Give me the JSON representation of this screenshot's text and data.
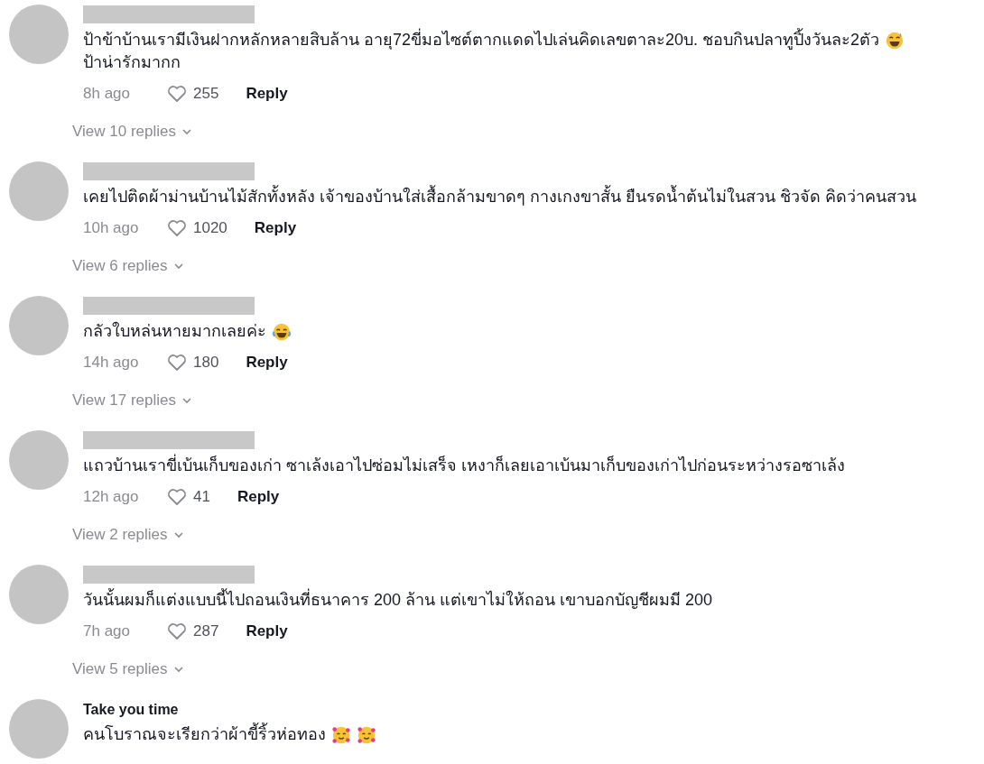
{
  "comments": [
    {
      "name_redacted": true,
      "lines": [
        [
          {
            "kind": "text",
            "text": "ป้าข้าบ้านเรามีเงินฝากหลักหลายสิบล้าน อายุ72ขี่มอไซต์ตากแดดไปเล่นคิดเลขตาละ20บ. ชอบกินปลาทูปิ้งวันละ2ตัว"
          },
          {
            "kind": "sweat-smile"
          }
        ],
        [
          {
            "kind": "text",
            "text": "ป้าน่ารักมากก"
          }
        ]
      ],
      "time": "8h ago",
      "likes": "255",
      "reply": "Reply",
      "view_replies": "View 10 replies"
    },
    {
      "name_redacted": true,
      "lines": [
        [
          {
            "kind": "text",
            "text": "เคยไปติดผ้าม่านบ้านไม้สักทั้งหลัง เจ้าของบ้านใส่เสื้อกล้ามขาดๆ กางเกงขาสั้น ยืนรดน้ำต้นไม่ในสวน ชิวจัด คิดว่าคนสวน"
          }
        ]
      ],
      "time": "10h ago",
      "likes": "1020",
      "reply": "Reply",
      "view_replies": "View 6 replies"
    },
    {
      "name_redacted": true,
      "lines": [
        [
          {
            "kind": "text",
            "text": "กลัวใบหล่นหายมากเลยค่ะ"
          },
          {
            "kind": "tears-of-joy"
          }
        ]
      ],
      "time": "14h ago",
      "likes": "180",
      "reply": "Reply",
      "view_replies": "View 17 replies"
    },
    {
      "name_redacted": true,
      "lines": [
        [
          {
            "kind": "text",
            "text": "แถวบ้านเราขี่เบ้นเก็บของเก่า ซาเล้งเอาไปซ่อมไม่เสร็จ เหงาก็เลยเอาเบ้นมาเก็บของเก่าไปก่อนระหว่างรอซาเล้ง"
          }
        ]
      ],
      "time": "12h ago",
      "likes": "41",
      "reply": "Reply",
      "view_replies": "View 2 replies"
    },
    {
      "name_redacted": true,
      "lines": [
        [
          {
            "kind": "text",
            "text": "วันนั้นผมก็แต่งแบบนี้ไปถอนเงินที่ธนาคาร 200 ล้าน แต่เขาไม่ให้ถอน เขาบอกบัญชีผมมี 200"
          }
        ]
      ],
      "time": "7h ago",
      "likes": "287",
      "reply": "Reply",
      "view_replies": "View 5 replies"
    },
    {
      "name_redacted": false,
      "username": "Take you time",
      "lines": [
        [
          {
            "kind": "text",
            "text": "คนโบราณจะเรียกว่าผ้าขี้ริ้วห่อทอง"
          },
          {
            "kind": "hearts"
          },
          {
            "kind": "hearts"
          }
        ]
      ]
    }
  ]
}
